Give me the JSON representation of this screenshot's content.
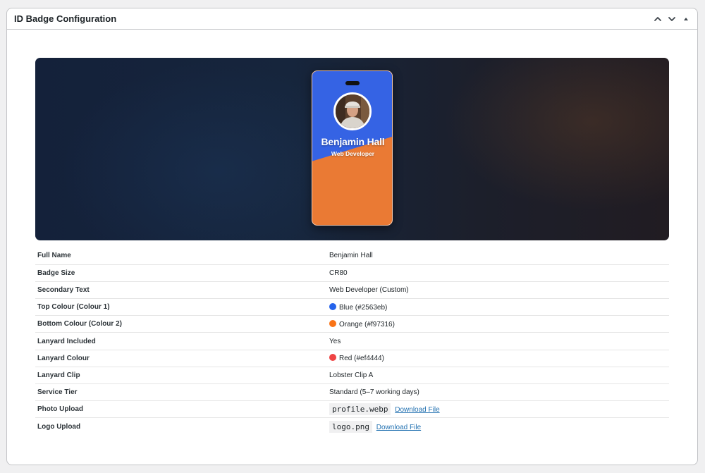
{
  "panel": {
    "title": "ID Badge Configuration"
  },
  "badge": {
    "name": "Benjamin Hall",
    "role": "Web Developer",
    "top_color": "#3563e4",
    "bottom_color": "#ea7a34"
  },
  "details": [
    {
      "label": "Full Name",
      "value": "Benjamin Hall"
    },
    {
      "label": "Badge Size",
      "value": "CR80"
    },
    {
      "label": "Secondary Text",
      "value": "Web Developer (Custom)"
    },
    {
      "label": "Top Colour (Colour 1)",
      "value": "Blue (#2563eb)",
      "swatch": "#2563eb"
    },
    {
      "label": "Bottom Colour (Colour 2)",
      "value": "Orange (#f97316)",
      "swatch": "#f97316"
    },
    {
      "label": "Lanyard Included",
      "value": "Yes"
    },
    {
      "label": "Lanyard Colour",
      "value": "Red (#ef4444)",
      "swatch": "#ef4444"
    },
    {
      "label": "Lanyard Clip",
      "value": "Lobster Clip A"
    },
    {
      "label": "Service Tier",
      "value": "Standard (5–7 working days)"
    },
    {
      "label": "Photo Upload",
      "file": "profile.webp",
      "link": "Download File"
    },
    {
      "label": "Logo Upload",
      "file": "logo.png",
      "link": "Download File"
    }
  ]
}
